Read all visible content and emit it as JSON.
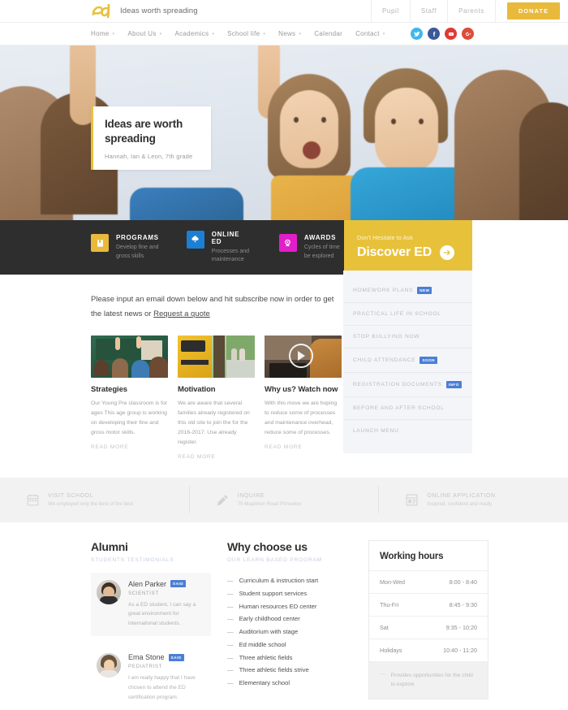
{
  "brand": {
    "name": "ed",
    "tagline": "Ideas worth spreading"
  },
  "topbar": {
    "links": [
      "Pupil",
      "Staff",
      "Parents"
    ],
    "donate_label": "DONATE",
    "donate_color": "#e8b93b"
  },
  "nav": {
    "items": [
      {
        "label": "Home",
        "caret": true
      },
      {
        "label": "About Us",
        "caret": true
      },
      {
        "label": "Academics",
        "caret": true
      },
      {
        "label": "School life",
        "caret": true
      },
      {
        "label": "News",
        "caret": true
      },
      {
        "label": "Calendar",
        "caret": false
      },
      {
        "label": "Contact",
        "caret": true
      }
    ],
    "socials": [
      {
        "name": "twitter-icon",
        "color": "#3fb7ec"
      },
      {
        "name": "facebook-icon",
        "color": "#3b5998"
      },
      {
        "name": "youtube-icon",
        "color": "#e03a35"
      },
      {
        "name": "googleplus-icon",
        "color": "#dd4b39"
      }
    ]
  },
  "hero": {
    "title": "Ideas are worth spreading",
    "subtitle": "Hannah, Ian & Leon, 7th grade",
    "accent_color": "#e8c13b"
  },
  "features": [
    {
      "title": "PROGRAMS",
      "desc": "Develop fine and gross skills",
      "color": "#e8b93b",
      "icon": "book-icon"
    },
    {
      "title": "ONLINE ED",
      "desc": "Processes and maintenance",
      "color": "#1b7fd4",
      "icon": "cloud-icon"
    },
    {
      "title": "AWARDS",
      "desc": "Cycles of time be explored",
      "color": "#e21ec9",
      "icon": "medal-icon"
    }
  ],
  "discover": {
    "kicker": "Don't Hesitate to Ask",
    "title": "Discover ED",
    "bg_color": "#e8c13b"
  },
  "intro": {
    "text_before": "Please input an email down below and hit subscribe now in order to get the latest news or ",
    "link_label": "Request a quote"
  },
  "cards": [
    {
      "title": "Strategies",
      "desc": "Our Young Pre classroom is for ages This age group is working on developing their fine and gross motor skills.",
      "more": "READ MORE"
    },
    {
      "title": "Motivation",
      "desc": "We are aware that several families already registered on this old site to join the for the 2016-2017. Use already register.",
      "more": "READ MORE"
    },
    {
      "title": "Why us? Watch now",
      "desc": "With this move we are hoping to reduce some of processes and maintenance overhead, reduce some of processes.",
      "more": "READ MORE"
    }
  ],
  "sidebar": {
    "items": [
      {
        "label": "HOMEWORK PLANS",
        "badge": "NEW"
      },
      {
        "label": "PRACTICAL LIFE IN SCHOOL",
        "badge": ""
      },
      {
        "label": "STOP BULLYING NOW",
        "badge": ""
      },
      {
        "label": "CHILD ATTENDANCE",
        "badge": "SOON"
      },
      {
        "label": "REGISTRATION DOCUMENTS",
        "badge": "INFO"
      },
      {
        "label": "BEFORE AND AFTER SCHOOL",
        "badge": ""
      },
      {
        "label": "LAUNCH MENU",
        "badge": ""
      }
    ],
    "badge_color": "#4a7fd6"
  },
  "strip": [
    {
      "title": "VISIT SCHOOL",
      "desc": "We employed only the best of the best",
      "icon": "calendar-icon"
    },
    {
      "title": "INQUIRE",
      "desc": "75 Mapleton Road Princeton",
      "icon": "pencil-icon"
    },
    {
      "title": "ONLINE APPLICATION",
      "desc": "Insipred, confident and ready.",
      "icon": "form-icon"
    }
  ],
  "alumni": {
    "title": "Alumni",
    "kicker": "STUDENTS TESTIMONIALS",
    "testimonials": [
      {
        "name": "Alen Parker",
        "badge": "SAID",
        "role": "SCIENTIST",
        "text": "As a ED student, I can say a great environment for international students."
      },
      {
        "name": "Ema Stone",
        "badge": "SAID",
        "role": "PEDIATRIST",
        "text": "I am really happy that I have chosen to attend the ED certification program."
      }
    ]
  },
  "why": {
    "title": "Why choose us",
    "kicker": "OUR LEARN BASED PROGRAM",
    "items": [
      "Curriculum & instruction start",
      "Student support services",
      "Human resources ED center",
      "Early childhood center",
      "Auditorium with stage",
      "Ed middle school",
      "Three athletic fields",
      "Three athletic fields strive",
      "Elementary school"
    ]
  },
  "hours": {
    "title": "Working hours",
    "rows": [
      {
        "day": "Mon-Wed",
        "time": "8:00 - 8:40"
      },
      {
        "day": "Thu-Fri",
        "time": "8:45 - 9:30"
      },
      {
        "day": "Sat",
        "time": "9:35 - 10:20"
      },
      {
        "day": "Holidays",
        "time": "10:40 - 11:20"
      }
    ],
    "note": "Provides opportunities for the child to explore"
  }
}
